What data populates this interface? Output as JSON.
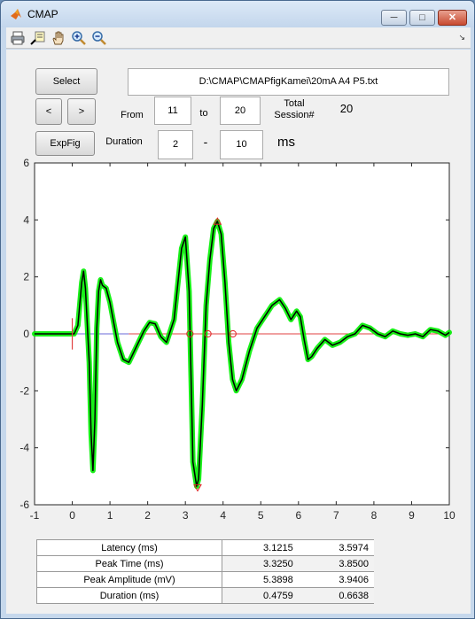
{
  "window": {
    "title": "CMAP"
  },
  "controls": {
    "select_label": "Select",
    "prev_label": "<",
    "next_label": ">",
    "expfig_label": "ExpFig",
    "file_path": "D:\\CMAP\\CMAPfigKamei\\20mA    A4 P5.txt",
    "from_label": "From",
    "from_value": "11",
    "to_label": "to",
    "to_value": "20",
    "total_label_line1": "Total",
    "total_label_line2": "Session#",
    "total_value": "20",
    "duration_label": "Duration",
    "duration_start": "2",
    "duration_dash": "-",
    "duration_end": "10",
    "duration_unit": "ms"
  },
  "results": {
    "rows": [
      {
        "label": "Latency (ms)",
        "values": [
          "3.1215",
          "3.5974"
        ]
      },
      {
        "label": "Peak Time (ms)",
        "values": [
          "3.3250",
          "3.8500"
        ]
      },
      {
        "label": "Peak Amplitude (mV)",
        "values": [
          "5.3898",
          "3.9406"
        ]
      },
      {
        "label": "Duration (ms)",
        "values": [
          "0.4759",
          "0.6638"
        ]
      }
    ]
  },
  "colors": {
    "trace_band": "#00ee00",
    "trace_mean": "#000000",
    "baseline_pre": "#6a6ad8",
    "baseline_post": "#e04040",
    "markers": "#e02020"
  },
  "icons": [
    "matlab-icon",
    "print-icon",
    "data-cursor-icon",
    "pan-hand-icon",
    "zoom-in-icon",
    "zoom-out-icon",
    "minimize-icon",
    "maximize-icon",
    "close-icon",
    "dock-arrow-icon"
  ],
  "chart_data": {
    "type": "line",
    "title": "",
    "xlabel": "",
    "ylabel": "",
    "xlim": [
      -1,
      10
    ],
    "ylim": [
      -6,
      6
    ],
    "x_ticks": [
      "-1",
      "0",
      "1",
      "2",
      "3",
      "4",
      "5",
      "6",
      "7",
      "8",
      "9",
      "10"
    ],
    "y_ticks": [
      "-6",
      "-4",
      "-2",
      "0",
      "2",
      "4",
      "6"
    ],
    "grid": false,
    "series": [
      {
        "x": [
          -1,
          -0.5,
          0,
          0.05,
          0.15,
          0.25,
          0.3,
          0.35,
          0.45,
          0.5,
          0.55,
          0.6,
          0.65,
          0.7,
          0.75,
          0.8,
          0.9,
          1.0,
          1.1,
          1.2,
          1.35,
          1.5,
          1.7,
          1.9,
          2.05,
          2.2,
          2.35,
          2.5,
          2.7,
          2.9,
          3.0,
          3.1,
          3.15,
          3.2,
          3.3,
          3.35,
          3.45,
          3.55,
          3.65,
          3.75,
          3.85,
          3.95,
          4.05,
          4.15,
          4.25,
          4.35,
          4.5,
          4.7,
          4.9,
          5.1,
          5.3,
          5.5,
          5.65,
          5.8,
          5.95,
          6.05,
          6.15,
          6.25,
          6.35,
          6.5,
          6.7,
          6.9,
          7.1,
          7.3,
          7.5,
          7.7,
          7.9,
          8.1,
          8.3,
          8.5,
          8.7,
          8.9,
          9.1,
          9.3,
          9.5,
          9.7,
          9.9,
          10
        ],
        "y": [
          0,
          0,
          0,
          0,
          0.3,
          1.8,
          2.2,
          1.6,
          -1.0,
          -3.5,
          -4.8,
          -3.0,
          0.2,
          1.5,
          1.9,
          1.7,
          1.6,
          1.1,
          0.4,
          -0.3,
          -0.9,
          -1.0,
          -0.45,
          0.1,
          0.4,
          0.35,
          -0.1,
          -0.3,
          0.5,
          3.0,
          3.4,
          1.5,
          -1.5,
          -4.5,
          -5.35,
          -5.1,
          -2.5,
          1.0,
          2.6,
          3.7,
          3.95,
          3.5,
          1.8,
          -0.3,
          -1.6,
          -2.0,
          -1.6,
          -0.6,
          0.2,
          0.6,
          1.0,
          1.2,
          0.9,
          0.5,
          0.8,
          0.6,
          -0.2,
          -0.9,
          -0.8,
          -0.5,
          -0.2,
          -0.4,
          -0.3,
          -0.1,
          0.0,
          0.3,
          0.2,
          0.0,
          -0.1,
          0.1,
          0.0,
          -0.05,
          0.0,
          -0.1,
          0.15,
          0.1,
          -0.05,
          0.05
        ]
      }
    ],
    "baseline": {
      "pre_x": [
        -1,
        1.5
      ],
      "post_x": [
        1.5,
        10
      ],
      "y": 0
    },
    "stim_marker_x": 0,
    "circle_markers_x": [
      3.1215,
      3.5974,
      4.26
    ],
    "peak_marker_down": {
      "x": 3.325,
      "y": -5.39
    },
    "peak_marker_up": {
      "x": 3.85,
      "y": 3.94
    }
  }
}
